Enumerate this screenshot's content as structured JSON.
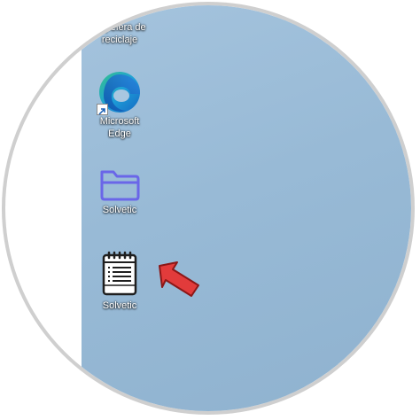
{
  "desktop": {
    "icons": [
      {
        "label": "Papelera de\nreciclaje",
        "icon": "recycle-bin-icon"
      },
      {
        "label": "Microsoft\nEdge",
        "icon": "edge-icon"
      },
      {
        "label": "Solvetic",
        "icon": "folder-icon"
      },
      {
        "label": "Solvetic",
        "icon": "notepad-icon"
      }
    ]
  },
  "colors": {
    "desktop_background": "#9dbfdb",
    "folder_accent": "#6a66e8",
    "annotation_arrow": "#e23b3b"
  }
}
